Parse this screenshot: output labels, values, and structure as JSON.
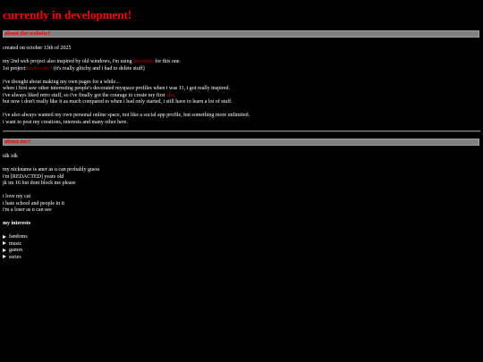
{
  "page_title": "currently in development!",
  "about_website": {
    "heading": "about the website?",
    "created": "created on october 13th of 2025",
    "line1_pre": "my 2nd web project also inspired by old windows, i'm using ",
    "line1_link": "Neocities",
    "line1_post": " for this one.",
    "line2_pre": "1st project:",
    "line2_link": "tuxdev.s4c3",
    "line2_post": " (it's really glitchy and i had to delete stuff)",
    "para2": [
      "i've thought about making my own pages for a while...",
      "when i first saw other interesting people's decorated myspace profiles when i was 11, i got really inspired."
    ],
    "line3_pre": "i've always liked retro stuff, so i've finally got the courage to create my first ",
    "line3_link": "site",
    "line3_post": ".",
    "line4": "but now i don't really like it as much compared to when i had only started, i still have to learn a lot of stuff.",
    "para3": [
      "i've also always wanted my own personal online space, not like a social app profile, but something more unlimited.",
      "i want to post my creations, interests and many other here."
    ]
  },
  "about_me": {
    "heading": "about me?",
    "intro": "idk idk",
    "para1": [
      "my nickname is aner as u can probably guess",
      "i'm [REDACTED] years old",
      "jk im 16 but dont block me please"
    ],
    "para2": [
      "i love my cat",
      "i hate school and people in it",
      "i'm a loser as u can see"
    ]
  },
  "interests": {
    "heading": "my interests",
    "items": [
      "fandoms",
      "music",
      "games",
      "series"
    ]
  },
  "colors": {
    "background": "#000000",
    "accent": "#ff0000",
    "link": "#b30000",
    "section_bar": "#808080"
  }
}
